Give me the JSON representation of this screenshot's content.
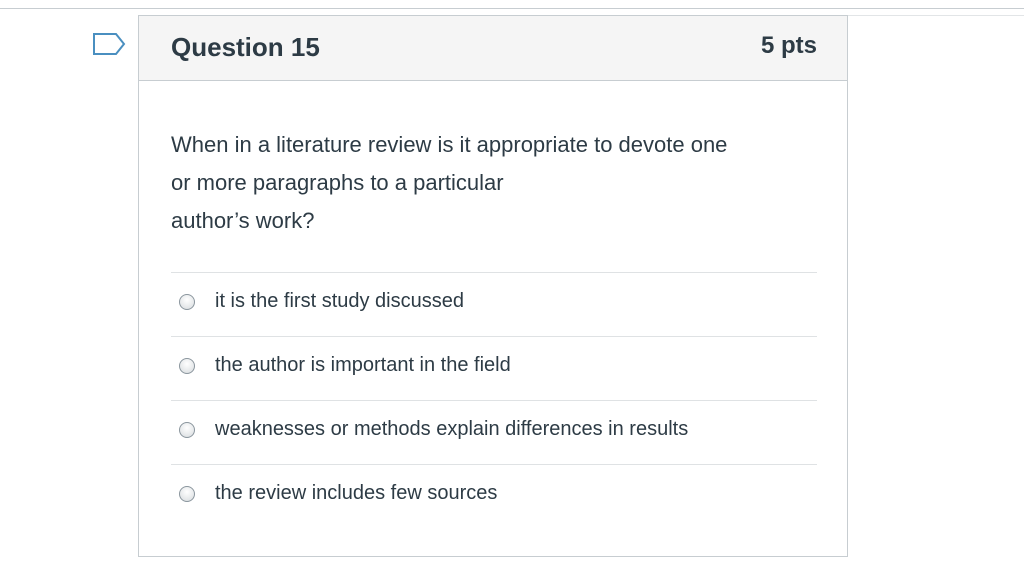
{
  "question": {
    "title": "Question 15",
    "points": "5 pts",
    "text_lines": [
      "When in a literature review is it appropriate to devote one",
      "or more paragraphs to a particular",
      "author’s work?"
    ],
    "answers": [
      {
        "label": "it is the first study discussed",
        "selected": false
      },
      {
        "label": "the author is important in the field",
        "selected": false
      },
      {
        "label": "weaknesses or methods explain differences in results",
        "selected": false
      },
      {
        "label": "the review includes few sources",
        "selected": false
      }
    ]
  },
  "flag": {
    "icon": "flag-question-icon",
    "color": "#4a8fc0"
  },
  "colors": {
    "text": "#2d3b45",
    "header_bg": "#f5f5f5",
    "border": "#c7cdd1"
  }
}
